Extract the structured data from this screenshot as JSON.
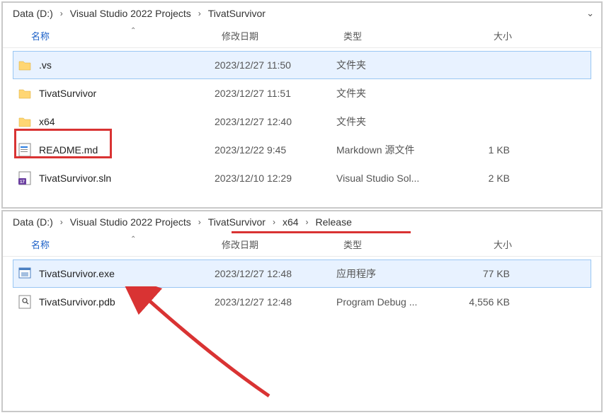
{
  "pane1": {
    "breadcrumb": {
      "root": "Data (D:)",
      "mid": "Visual Studio 2022 Projects",
      "leaf": "TivatSurvivor"
    },
    "headers": {
      "name": "名称",
      "date": "修改日期",
      "type": "类型",
      "size": "大小"
    },
    "rows": [
      {
        "icon": "folder",
        "name": ".vs",
        "date": "2023/12/27 11:50",
        "type": "文件夹",
        "size": "",
        "selected": true
      },
      {
        "icon": "folder",
        "name": "TivatSurvivor",
        "date": "2023/12/27 11:51",
        "type": "文件夹",
        "size": "",
        "selected": false
      },
      {
        "icon": "folder",
        "name": "x64",
        "date": "2023/12/27 12:40",
        "type": "文件夹",
        "size": "",
        "selected": false
      },
      {
        "icon": "md",
        "name": "README.md",
        "date": "2023/12/22 9:45",
        "type": "Markdown 源文件",
        "size": "1 KB",
        "selected": false
      },
      {
        "icon": "sln",
        "name": "TivatSurvivor.sln",
        "date": "2023/12/10 12:29",
        "type": "Visual Studio Sol...",
        "size": "2 KB",
        "selected": false
      }
    ]
  },
  "pane2": {
    "breadcrumb": {
      "root": "Data (D:)",
      "p1": "Visual Studio 2022 Projects",
      "p2": "TivatSurvivor",
      "p3": "x64",
      "p4": "Release"
    },
    "headers": {
      "name": "名称",
      "date": "修改日期",
      "type": "类型",
      "size": "大小"
    },
    "rows": [
      {
        "icon": "exe",
        "name": "TivatSurvivor.exe",
        "date": "2023/12/27 12:48",
        "type": "应用程序",
        "size": "77 KB",
        "selected": true
      },
      {
        "icon": "pdb",
        "name": "TivatSurvivor.pdb",
        "date": "2023/12/27 12:48",
        "type": "Program Debug ...",
        "size": "4,556 KB",
        "selected": false
      }
    ]
  }
}
